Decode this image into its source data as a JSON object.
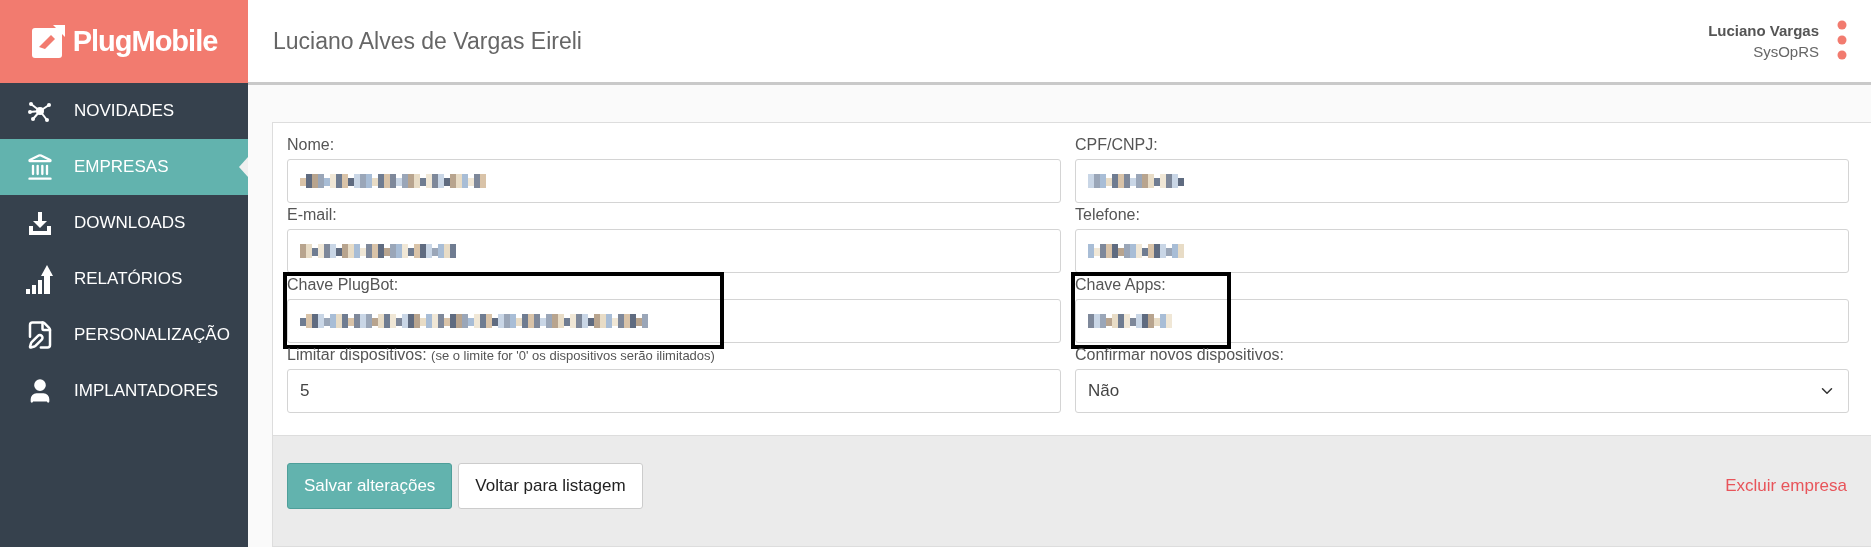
{
  "brand": "PlugMobile",
  "header": {
    "title": "Luciano Alves de Vargas Eireli",
    "user_name": "Luciano Vargas",
    "user_role": "SysOpRS"
  },
  "sidebar": {
    "items": [
      {
        "label": "NOVIDADES",
        "selected": false
      },
      {
        "label": "EMPRESAS",
        "selected": true
      },
      {
        "label": "DOWNLOADS",
        "selected": false
      },
      {
        "label": "RELATÓRIOS",
        "selected": false
      },
      {
        "label": "PERSONALIZAÇÃO",
        "selected": false
      },
      {
        "label": "IMPLANTADORES",
        "selected": false
      }
    ]
  },
  "form": {
    "fields": [
      {
        "kind": "text",
        "label": "Nome:",
        "redacted": true,
        "highlighted": false
      },
      {
        "kind": "text",
        "label": "CPF/CNPJ:",
        "redacted": true,
        "highlighted": false
      },
      {
        "kind": "text",
        "label": "E-mail:",
        "redacted": true,
        "highlighted": false
      },
      {
        "kind": "text",
        "label": "Telefone:",
        "redacted": true,
        "highlighted": false
      },
      {
        "kind": "text",
        "label": "Chave PlugBot:",
        "redacted": true,
        "highlighted": true
      },
      {
        "kind": "text",
        "label": "Chave Apps:",
        "redacted": true,
        "highlighted": true
      },
      {
        "kind": "text",
        "label": "Limitar dispositivos:",
        "note": "(se o limite for '0' os dispositivos serão ilimitados)",
        "value": "5",
        "highlighted": false
      },
      {
        "kind": "select",
        "label": "Confirmar novos dispositivos:",
        "value": "Não",
        "highlighted": false
      }
    ],
    "buttons": [
      {
        "label": "Salvar alterações",
        "kind": "primary"
      },
      {
        "label": "Voltar para listagem",
        "kind": "default"
      }
    ],
    "delete_link": "Excluir empresa"
  }
}
